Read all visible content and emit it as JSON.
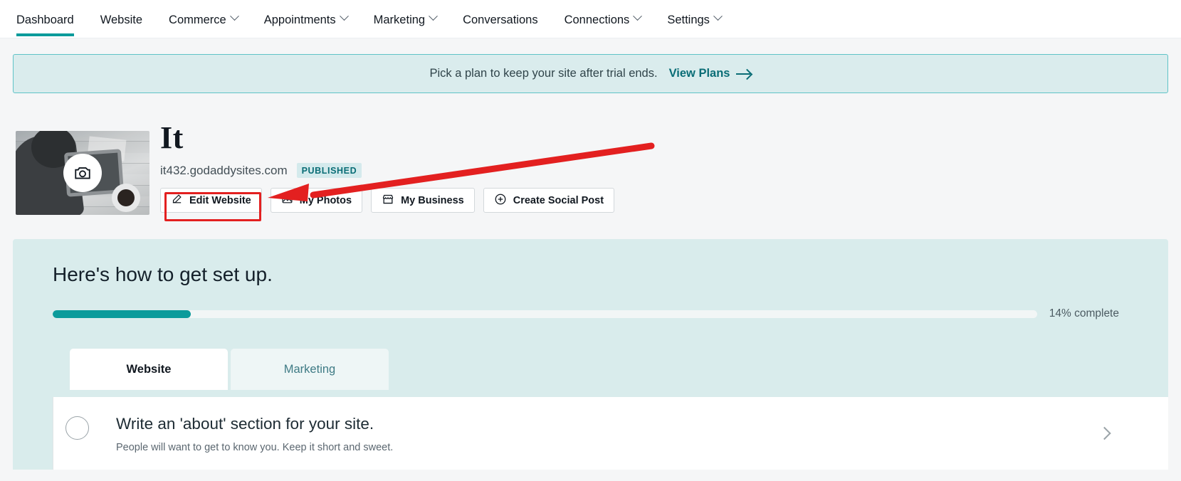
{
  "nav": {
    "items": [
      {
        "label": "Dashboard",
        "caret": false,
        "active": true
      },
      {
        "label": "Website",
        "caret": false,
        "active": false
      },
      {
        "label": "Commerce",
        "caret": true,
        "active": false
      },
      {
        "label": "Appointments",
        "caret": true,
        "active": false
      },
      {
        "label": "Marketing",
        "caret": true,
        "active": false
      },
      {
        "label": "Conversations",
        "caret": false,
        "active": false
      },
      {
        "label": "Connections",
        "caret": true,
        "active": false
      },
      {
        "label": "Settings",
        "caret": true,
        "active": false
      }
    ]
  },
  "banner": {
    "text": "Pick a plan to keep your site after trial ends.",
    "link_label": "View Plans",
    "arrow_icon": "arrow-right-icon",
    "bg_color": "#daeced",
    "border_color": "#5fc3c7",
    "link_color": "#0a6d76"
  },
  "site": {
    "title": "It",
    "url": "it432.godaddysites.com",
    "status_badge": "PUBLISHED",
    "badge_bg": "#d4eaec",
    "badge_color": "#0a6d76",
    "thumbnail_overlay_icon": "camera-icon",
    "actions": [
      {
        "label": "Edit Website",
        "icon": "pencil-icon"
      },
      {
        "label": "My Photos",
        "icon": "photo-icon"
      },
      {
        "label": "My Business",
        "icon": "storefront-icon"
      },
      {
        "label": "Create Social Post",
        "icon": "plus-circle-icon"
      }
    ]
  },
  "setup": {
    "heading": "Here's how to get set up.",
    "progress_percent": 14,
    "progress_label": "14% complete",
    "progress_color": "#0b9b9b",
    "card_bg": "#d9ecec",
    "tabs": [
      {
        "label": "Website",
        "active": true
      },
      {
        "label": "Marketing",
        "active": false
      }
    ],
    "tasks": [
      {
        "title": "Write an 'about' section for your site.",
        "subtitle": "People will want to get to know you. Keep it short and sweet.",
        "completed": false,
        "chevron_icon": "chevron-right-icon"
      }
    ]
  },
  "annotations": {
    "highlight_color": "#e32020",
    "highlight_target": "Edit Website",
    "arrow_icon": "annotation-arrow-icon"
  }
}
